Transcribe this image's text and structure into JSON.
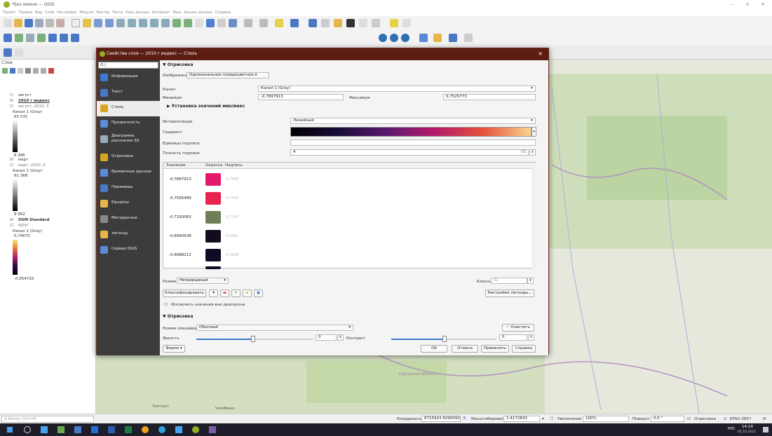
{
  "app": {
    "title": "*Без имени — QGIS",
    "menu": [
      "Проект",
      "Правка",
      "Вид",
      "Слой",
      "Настройки",
      "Модули",
      "Вектор",
      "Растр",
      "База данных",
      "Интернет",
      "Меш",
      "Анализ данных",
      "Справка"
    ]
  },
  "layers_panel": {
    "title": "Слои",
    "items": [
      {
        "name": "август",
        "style": "layer"
      },
      {
        "name": "2010 г индекс",
        "style": "bold-underline"
      },
      {
        "name": "август, 2010, 3",
        "style": "italic"
      },
      {
        "name": "Канал 1 (Gray)",
        "style": "plain"
      },
      {
        "name": "65 535",
        "style": "value"
      },
      {
        "name": "6 286",
        "style": "value"
      },
      {
        "name": "март",
        "style": "layer"
      },
      {
        "name": "март, 2010, 4",
        "style": "italic"
      },
      {
        "name": "Канал 1 (Gray)",
        "style": "plain"
      },
      {
        "name": "61 368",
        "style": "value"
      },
      {
        "name": "9 062",
        "style": "value"
      },
      {
        "name": "OSM Standard",
        "style": "bold"
      },
      {
        "name": "NDVI",
        "style": "italic"
      },
      {
        "name": "Канал 1 (Gray)",
        "style": "plain"
      },
      {
        "name": "0,74675",
        "style": "value"
      },
      {
        "name": "-0,054726",
        "style": "value"
      }
    ]
  },
  "map": {
    "labels": [
      "Курганская область",
      "Златоуст",
      "Челябинск"
    ]
  },
  "dialog": {
    "title": "Свойства слоя — 2010 г индекс — Стиль",
    "search_placeholder": "Q |",
    "nav": [
      "Информация",
      "Текст",
      "Стиль",
      "Прозрачность",
      "Диаграмма рассеяния 3D",
      "Отрисовка",
      "Временные данные",
      "Пирамиды",
      "Elevation",
      "Метаданные",
      "легенду",
      "Сервер QGIS"
    ],
    "render_section": "Отрисовка",
    "render_type_label": "Изображение",
    "render_type": "Одноканальное псевдоцветное",
    "band_label": "Канал",
    "band": "Канал 1 (Gray)",
    "min_label": "Минимум",
    "min": "-0,7897913",
    "max_label": "Максимум",
    "max": "0,7525773",
    "minmax_section": "Установка значений мин/макс",
    "interp_label": "Интерполяция",
    "interp": "Линейный",
    "gradient_label": "Градиент",
    "units_label": "Единицы подписи",
    "precision_label": "Точность подписи",
    "precision": "4",
    "table_headers": [
      "Значение",
      "Окраска",
      "Надпись"
    ],
    "rows": [
      {
        "value": "-0,7897913",
        "color": "#e5196c",
        "label": "-0,7898"
      },
      {
        "value": "-0,7595489",
        "color": "#e8234e",
        "label": "-0,7595"
      },
      {
        "value": "-0,7293063",
        "color": "#6f7f55",
        "label": "-0,7293"
      },
      {
        "value": "-0,6990638",
        "color": "#140c1e",
        "label": "-0,6991"
      },
      {
        "value": "-0,6688212",
        "color": "#100a24",
        "label": "-0,6688"
      }
    ],
    "mode_label": "Режим",
    "mode": "Непрерывный",
    "classes_label": "Классы",
    "classes": "52",
    "classify_btn": "Классифицировать",
    "legend_settings_btn": "Настройки легенды...",
    "clip_label": "Исключить значения вне диапазона",
    "render2_section": "Отрисовка",
    "blend_label": "Режим смешивания",
    "blend": "Обычный",
    "reset_btn": "Очистить",
    "brightness_label": "Яркость",
    "brightness": "0",
    "contrast_label": "Контраст",
    "contrast": "0",
    "style_btn": "Форма",
    "ok_btn": "OK",
    "cancel_btn": "Отмена",
    "apply_btn": "Применить",
    "help_btn": "Справка"
  },
  "status": {
    "search_placeholder": "Q  Искать (Ctrl+K)",
    "coord_label": "Координаты",
    "coord": "6715924 8299393",
    "scale_label": "Масштабировать",
    "scale": "1:4172833",
    "zoom_label": "Увеличение",
    "zoom": "100%",
    "rotation_label": "Поворот",
    "rotation": "0,0 °",
    "render_label": "Отрисовка",
    "crs": "EPSG:3857"
  },
  "taskbar": {
    "time": "14:19",
    "date": "05.10.2022",
    "lang": "РУС"
  },
  "colors": {
    "accent": "#5b1d14",
    "nav_bg": "#3c3c3c"
  }
}
